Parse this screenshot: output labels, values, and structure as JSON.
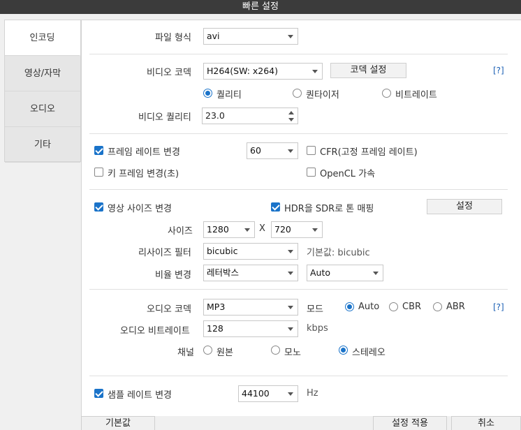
{
  "window": {
    "title": "빠른 설정"
  },
  "sidebar": {
    "items": [
      {
        "label": "인코딩"
      },
      {
        "label": "영상/자막"
      },
      {
        "label": "오디오"
      },
      {
        "label": "기타"
      }
    ]
  },
  "encoding": {
    "file_format_label": "파일 형식",
    "file_format": "avi",
    "video_codec_label": "비디오 코덱",
    "video_codec": "H264(SW: x264)",
    "codec_settings_button": "코덱 설정",
    "help": "[?]",
    "mode_quality": "퀄리티",
    "mode_quantizer": "퀀타이저",
    "mode_bitrate": "비트레이트",
    "video_quality_label": "비디오 퀄리티",
    "video_quality": "23.0"
  },
  "framerate": {
    "change_label": "프레임 레이트 변경",
    "value": "60",
    "cfr_label": "CFR(고정 프레임 레이트)",
    "keyframe_label": "키 프레임 변경(초)",
    "opencl_label": "OpenCL 가속"
  },
  "size": {
    "change_label": "영상 사이즈 변경",
    "hdr_label": "HDR을 SDR로 톤 매핑",
    "settings_button": "설정",
    "size_label": "사이즈",
    "width": "1280",
    "x_label": "X",
    "height": "720",
    "resize_filter_label": "리사이즈 필터",
    "resize_filter": "bicubic",
    "default_hint": "기본값: bicubic",
    "ratio_label": "비율 변경",
    "ratio": "레터박스",
    "ratio_mode": "Auto"
  },
  "audio": {
    "codec_label": "오디오 코덱",
    "codec": "MP3",
    "mode_label": "모드",
    "mode_abr_auto": "Auto",
    "mode_cbr": "CBR",
    "mode_abr": "ABR",
    "help": "[?]",
    "bitrate_label": "오디오 비트레이트",
    "bitrate": "128",
    "bitrate_unit": "kbps",
    "channel_label": "채널",
    "channel_original": "원본",
    "channel_mono": "모노",
    "channel_stereo": "스테레오",
    "samplerate_label": "샘플 레이트 변경",
    "samplerate": "44100",
    "samplerate_unit": "Hz"
  },
  "footer": {
    "default_button": "기본값",
    "apply_button": "설정 적용",
    "cancel_button": "취소"
  },
  "colors": {
    "accent": "#1a73c9",
    "titlebar": "#3b3b3b"
  }
}
